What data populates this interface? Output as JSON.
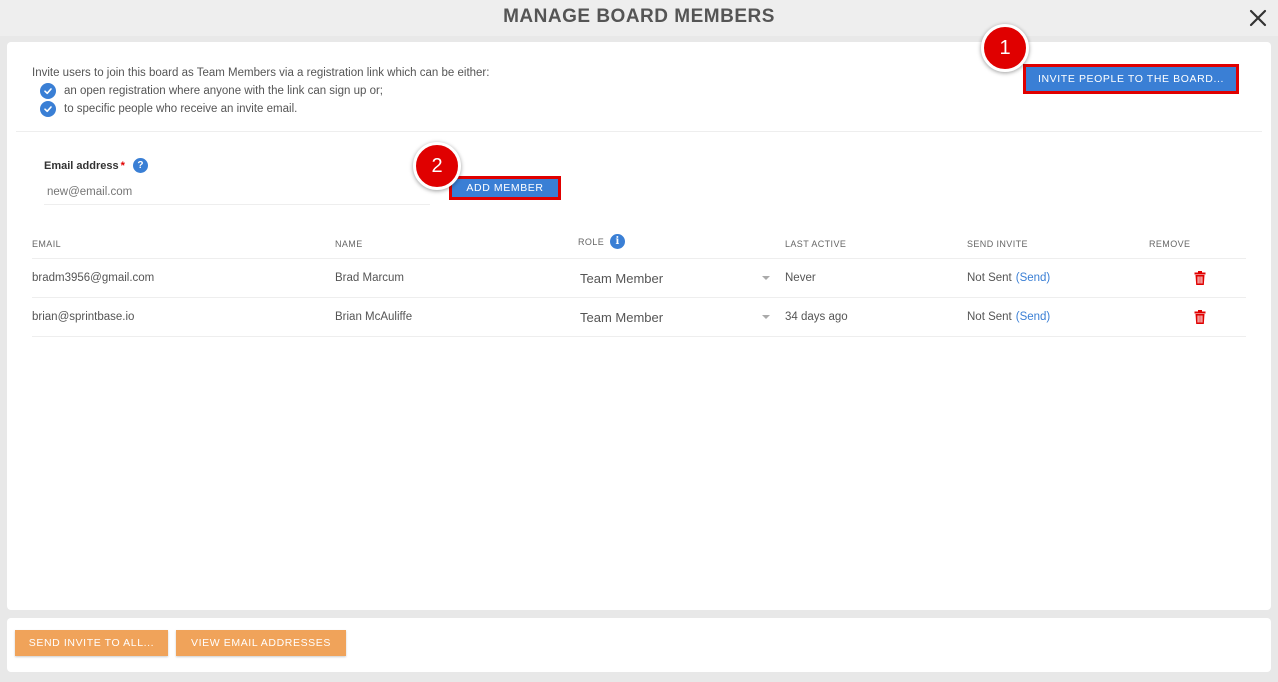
{
  "dialog": {
    "title": "MANAGE BOARD MEMBERS"
  },
  "intro": {
    "text": "Invite users to join this board as Team Members via a registration link which can be either:",
    "bullets": [
      "an open registration where anyone with the link can sign up or;",
      "to specific people who receive an invite email."
    ]
  },
  "invite_button": {
    "label": "INVITE PEOPLE TO THE BOARD..."
  },
  "markers": {
    "one": "1",
    "two": "2"
  },
  "email_form": {
    "label": "Email address",
    "required_mark": "*",
    "help_icon": "?",
    "placeholder": "new@email.com",
    "add_label": "ADD MEMBER"
  },
  "table": {
    "headers": {
      "email": "EMAIL",
      "name": "NAME",
      "role": "ROLE",
      "last_active": "LAST ACTIVE",
      "send_invite": "SEND INVITE",
      "remove": "REMOVE"
    },
    "rows": [
      {
        "email": "bradm3956@gmail.com",
        "name": "Brad Marcum",
        "role": "Team Member",
        "last_active": "Never",
        "invite_status": "Not Sent",
        "send_link": "(Send)"
      },
      {
        "email": "brian@sprintbase.io",
        "name": "Brian McAuliffe",
        "role": "Team Member",
        "last_active": "34 days ago",
        "invite_status": "Not Sent",
        "send_link": "(Send)"
      }
    ]
  },
  "footer": {
    "send_all_label": "SEND INVITE TO ALL...",
    "view_emails_label": "VIEW EMAIL ADDRESSES"
  },
  "colors": {
    "primary": "#3a7fd5",
    "highlight": "#e00000",
    "orange": "#f0a35a"
  }
}
